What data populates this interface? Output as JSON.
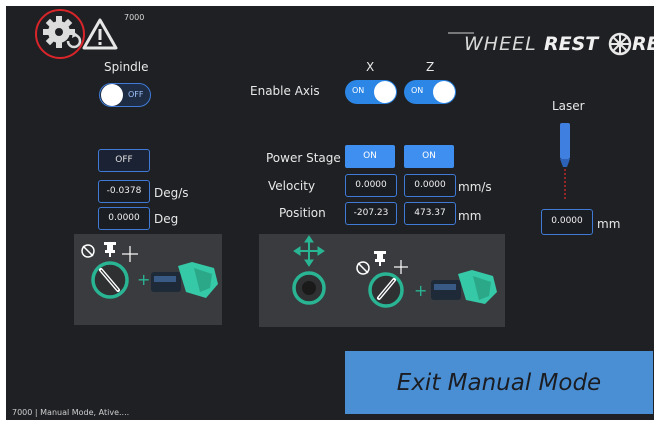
{
  "header": {
    "code": "7000",
    "brand_thin": "WHEEL",
    "brand_bold": "REST",
    "brand_tail": "RE"
  },
  "spindle": {
    "label": "Spindle",
    "toggle_state": "OFF",
    "status_button": "OFF",
    "speed_value": "-0.0378",
    "speed_unit": "Deg/s",
    "angle_value": "0.0000",
    "angle_unit": "Deg"
  },
  "axes": {
    "enable_label": "Enable Axis",
    "x": {
      "label": "X",
      "toggle_state": "ON",
      "power": "ON",
      "velocity": "0.0000",
      "position": "-207.23"
    },
    "z": {
      "label": "Z",
      "toggle_state": "ON",
      "power": "ON",
      "velocity": "0.0000",
      "position": "473.37"
    },
    "power_label": "Power Stage",
    "velocity_label": "Velocity",
    "velocity_unit": "mm/s",
    "position_label": "Position",
    "position_unit": "mm"
  },
  "laser": {
    "label": "Laser",
    "value": "0.0000",
    "unit": "mm"
  },
  "exit_button": "Exit Manual Mode",
  "status_bar": "7000 | Manual Mode, Ative....",
  "colors": {
    "accent": "#3f8ff0",
    "background": "#1e2023",
    "highlight_circle": "#d9252a",
    "tool_green": "#29b594"
  }
}
